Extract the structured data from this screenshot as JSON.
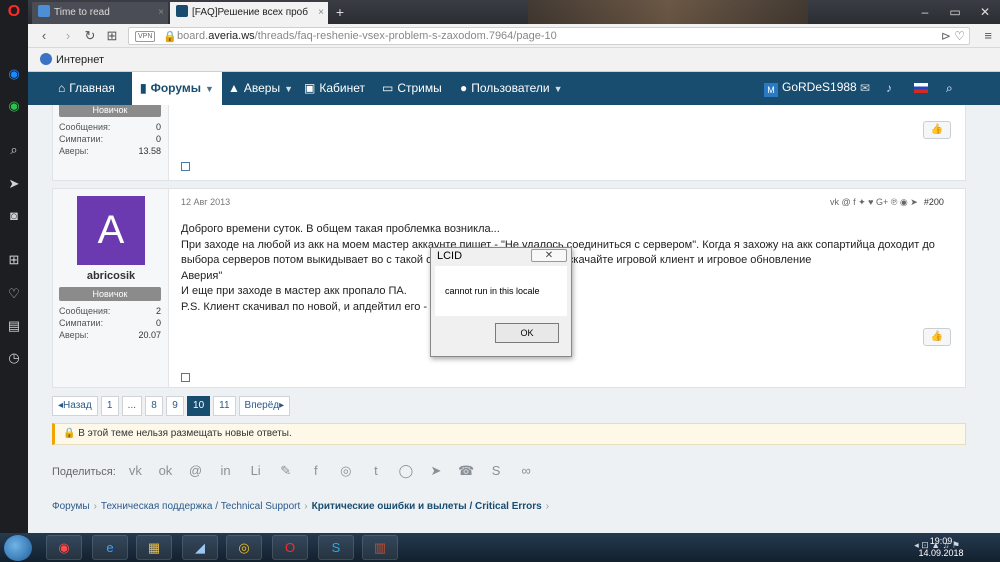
{
  "browser": {
    "tabs": [
      {
        "label": "Time to read"
      },
      {
        "label": "[FAQ]Решение всех проб"
      }
    ],
    "new_tab": "+",
    "vpn_badge": "VPN",
    "url_prefix": "board.",
    "url_domain": "averia.ws",
    "url_path": "/threads/faq-reshenie-vsex-problem-s-zaxodom.7964/page-10",
    "bookmark": "Интернет"
  },
  "forum_nav": {
    "items": [
      {
        "label": "Главная"
      },
      {
        "label": "Форумы"
      },
      {
        "label": "Аверы"
      },
      {
        "label": "Кабинет"
      },
      {
        "label": "Стримы"
      },
      {
        "label": "Пользователи"
      }
    ],
    "username": "GoRDeS1988",
    "avatar_letter": "M"
  },
  "post1": {
    "rank": "Новичок",
    "stats": [
      {
        "label": "Сообщения:",
        "value": "0"
      },
      {
        "label": "Симпатии:",
        "value": "0"
      },
      {
        "label": "Аверы:",
        "value": "13.58"
      }
    ]
  },
  "post2": {
    "avatar_letter": "A",
    "username": "abricosik",
    "rank": "Новичок",
    "stats": [
      {
        "label": "Сообщения:",
        "value": "2"
      },
      {
        "label": "Симпатии:",
        "value": "0"
      },
      {
        "label": "Аверы:",
        "value": "20.07"
      }
    ],
    "date": "12 Авг 2013",
    "post_number": "#200",
    "lines": [
      "Доброго времени суток. В общем такая проблемка возникла...",
      "При заходе на любой из акк на моем мастер аккаунте пишет - \"Не удалось соединиться с сервером\". Когда я захожу на акк сопартийца доходит до",
      "выбора серверов потом выкидывает во с такой о... протокола. Пожалуйста скачайте игровой клиент и игровое обновление",
      "Аверия\"",
      "И еще при заходе в мастер акк пропало ПА.",
      "P.S. Клиент скачивал по новой, и апдейтил его - н..."
    ]
  },
  "pagination": {
    "prev": "◂Назад",
    "pages": [
      "1",
      "...",
      "8",
      "9",
      "10",
      "11"
    ],
    "current": "10",
    "next": "Вперёд▸"
  },
  "notice": "В этой теме нельзя размещать новые ответы.",
  "share_label": "Поделиться:",
  "breadcrumbs": [
    "Форумы",
    "Техническая поддержка / Technical Support",
    "Критические ошибки и вылеты / Critical Errors"
  ],
  "dialog": {
    "title": "LCID",
    "message": "cannot run in this locale",
    "ok": "OK"
  },
  "taskbar": {
    "time": "19:09",
    "date": "14.09.2018"
  }
}
